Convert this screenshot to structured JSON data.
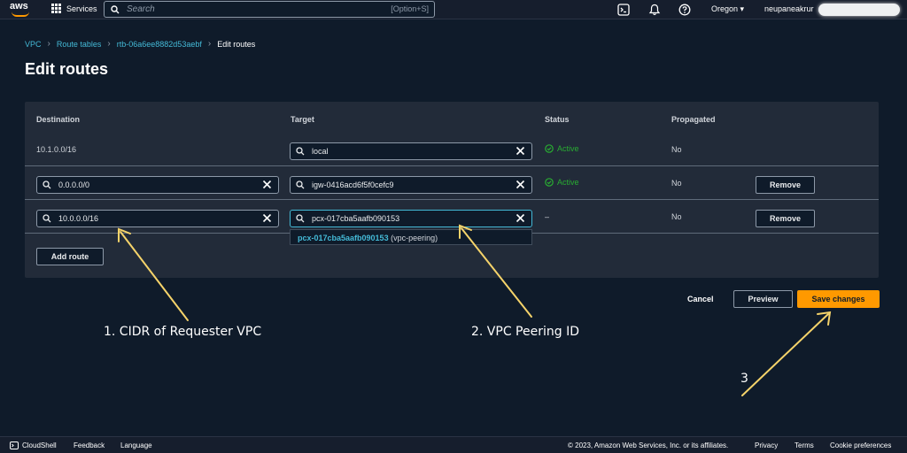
{
  "topnav": {
    "logo": "aws",
    "services_label": "Services",
    "search_placeholder": "Search",
    "search_shortcut": "[Option+S]",
    "region": "Oregon ▾",
    "user": "neupaneakrur"
  },
  "breadcrumb": [
    "VPC",
    "Route tables",
    "rtb-06a6ee8882d53aebf",
    "Edit routes"
  ],
  "page_title": "Edit routes",
  "table": {
    "headers": [
      "Destination",
      "Target",
      "Status",
      "Propagated"
    ],
    "rows": [
      {
        "destination": "10.1.0.0/16",
        "target": "local",
        "status": "Active",
        "propagated": "No"
      },
      {
        "destination": "0.0.0.0/0",
        "target": "igw-0416acd6f5f0cefc9",
        "status": "Active",
        "propagated": "No",
        "remove": "Remove"
      },
      {
        "destination": "10.0.0.0/16",
        "target": "pcx-017cba5aafb090153",
        "status": "–",
        "propagated": "No",
        "remove": "Remove"
      }
    ],
    "suggestion_id": "pcx-017cba5aafb090153",
    "suggestion_suffix": " (vpc-peering)",
    "add_route": "Add route"
  },
  "actions": {
    "cancel": "Cancel",
    "preview": "Preview",
    "save": "Save changes"
  },
  "annotations": {
    "one": "1. CIDR of Requester VPC",
    "two": "2. VPC Peering ID",
    "three": "3"
  },
  "footer": {
    "cloudshell": "CloudShell",
    "feedback": "Feedback",
    "language": "Language",
    "copyright": "© 2023, Amazon Web Services, Inc. or its affiliates.",
    "privacy": "Privacy",
    "terms": "Terms",
    "cookies": "Cookie preferences"
  },
  "colors": {
    "accent": "#ff9900",
    "link": "#44b9d6",
    "success": "#29ad32",
    "annotation_arrow": "#f5d36a"
  },
  "icons": [
    "grid-icon",
    "search-icon",
    "cloudshell-icon",
    "bell-icon",
    "help-icon",
    "clear-icon",
    "check-circle-icon"
  ]
}
